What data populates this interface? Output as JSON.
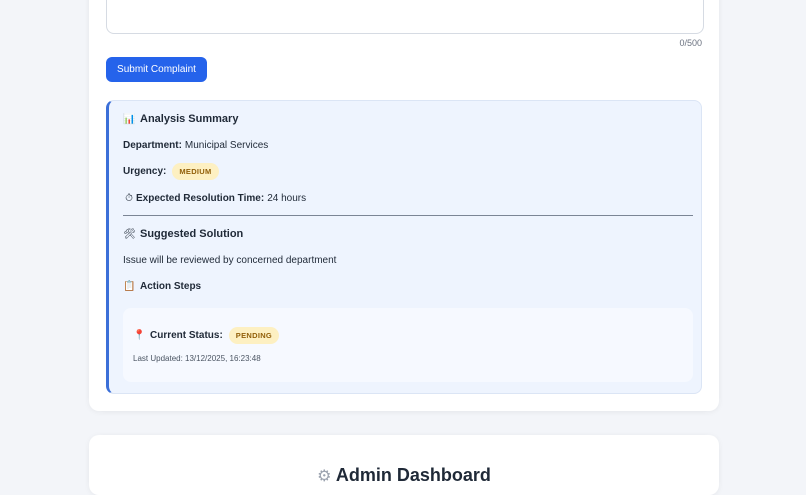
{
  "form": {
    "char_count": "0/500",
    "submit_label": "Submit Complaint"
  },
  "analysis": {
    "summary_icon": "📊",
    "summary_title": "Analysis Summary",
    "department_label": "Department:",
    "department_value": "Municipal Services",
    "urgency_label": "Urgency:",
    "urgency_value": "MEDIUM",
    "time_icon": "⏱",
    "time_label": "Expected Resolution Time:",
    "time_value": "24 hours",
    "solution_icon": "🛠",
    "solution_title": "Suggested Solution",
    "solution_text": "Issue will be reviewed by concerned department",
    "steps_icon": "📋",
    "steps_title": "Action Steps"
  },
  "status": {
    "pin_icon": "📍",
    "label": "Current Status:",
    "value": "PENDING",
    "last_updated": "Last Updated: 13/12/2025, 16:23:48"
  },
  "admin": {
    "icon": "⚙",
    "title": "Admin Dashboard"
  },
  "colors": {
    "accent": "#2563eb",
    "badge_bg": "#fdf0c2",
    "badge_text": "#92600a",
    "panel_bg": "#eef4fe",
    "panel_border": "#3b6fd8"
  }
}
